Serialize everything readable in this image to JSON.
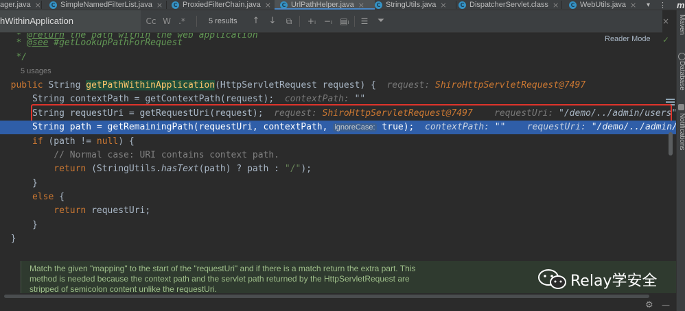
{
  "tabs": [
    {
      "label": "ager.java",
      "icon": "class-icon",
      "closable": true
    },
    {
      "label": "SimpleNamedFilterList.java",
      "icon": "class-icon",
      "closable": true
    },
    {
      "label": "ProxiedFilterChain.java",
      "icon": "class-icon",
      "closable": true
    },
    {
      "label": "UrlPathHelper.java",
      "icon": "class-icon",
      "closable": true,
      "active": true
    },
    {
      "label": "StringUtils.java",
      "icon": "class-icon",
      "closable": true
    },
    {
      "label": "DispatcherServlet.class",
      "icon": "class-icon",
      "closable": true
    },
    {
      "label": "WebUtils.java",
      "icon": "class-icon",
      "closable": true
    },
    {
      "label": "m",
      "icon": "maven-icon"
    }
  ],
  "find_bar": {
    "query": "hWithinApplication",
    "results": "5 results",
    "buttons": [
      "Cc",
      "W",
      ".*"
    ]
  },
  "side_panel": {
    "labels": [
      "Maven",
      "Database",
      "Notifications"
    ]
  },
  "editor": {
    "reader_mode": "Reader Mode",
    "usages": "5 usages",
    "doc_text": "Match the given \"mapping\" to the start of the \"requestUri\" and if there is a match return the extra part. This method is needed because the context path and the servlet path returned by the HttpServletRequest are stripped of semicolon content unlike the requestUri."
  },
  "code": {
    "l0_tag": "@return",
    "l0_text": " the path within the web application",
    "l1_tag": "@see",
    "l1_ref": "#getLookupPathForRequest",
    "l2": "*/",
    "l3_pre": "public String ",
    "l3_name": "getPathWithinApplication",
    "l3_args": "(HttpServletRequest request) {",
    "l3_hint_k": "request: ",
    "l3_hint_v": "ShiroHttpServletRequest@7497",
    "l4_code": "String contextPath = getContextPath(request);",
    "l4_hint_k": "contextPath: ",
    "l4_hint_v": "\"\"",
    "l5_code": "String requestUri = getRequestUri(request);",
    "l5_hint1_k": "request: ",
    "l5_hint1_v": "ShiroHttpServletRequest@7497",
    "l5_hint2_k": "requestUri: ",
    "l5_hint2_v": "\"/demo/../admin/users\"",
    "l6_code": "String path = getRemainingPath(requestUri, contextPath, ",
    "l6_inlay": "ignoreCase:",
    "l6_end": " true);",
    "l6_hint1_k": "contextPath: ",
    "l6_hint1_v": "\"\"",
    "l6_hint2_k": "requestUri: ",
    "l6_hint2_v": "\"/demo/../admin/use",
    "l7_kw": "if",
    "l7_rest": " (path != ",
    "l7_null": "null",
    "l7_end": ") {",
    "l8": "// Normal case: URI contains context path.",
    "l9_kw": "return",
    "l9_a": " (StringUtils.",
    "l9_m": "hasText",
    "l9_b": "(path) ? path : ",
    "l9_s": "\"/\"",
    "l9_c": ");",
    "l10": "}",
    "l11_kw": "else",
    "l11_rest": " {",
    "l12_kw": "return",
    "l12_rest": " requestUri;",
    "l13": "}",
    "l14": "}"
  },
  "watermark": "Relay学安全",
  "colors": {
    "background": "#2b2b2b",
    "keyword": "#cc7832",
    "method": "#ffc66d",
    "string": "#6a8759",
    "execution_line": "#2f5ea8",
    "annotation_box": "#e0342b"
  }
}
